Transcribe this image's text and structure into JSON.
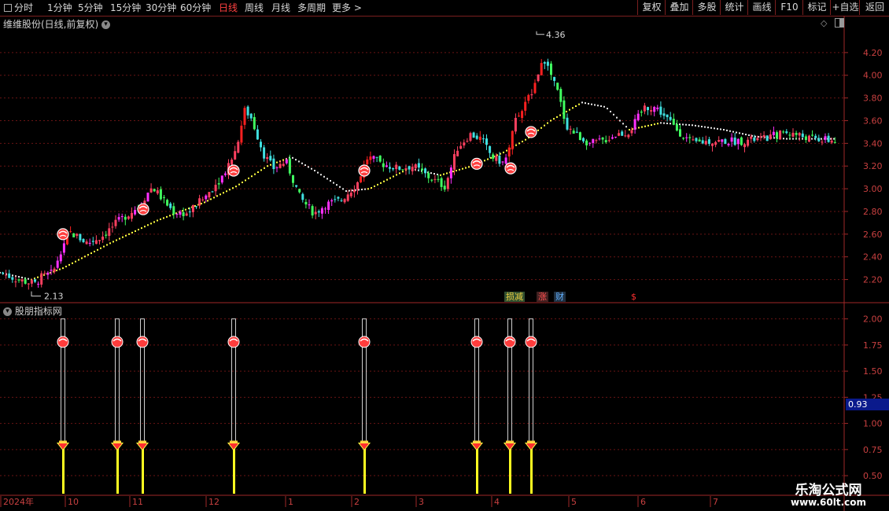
{
  "toolbar": {
    "left": [
      {
        "label": "分时",
        "x": 18,
        "active": false
      },
      {
        "label": "1分钟",
        "x": 60,
        "active": false
      },
      {
        "label": "5分钟",
        "x": 99,
        "active": false
      },
      {
        "label": "15分钟",
        "x": 140,
        "active": false
      },
      {
        "label": "30分钟",
        "x": 185,
        "active": false
      },
      {
        "label": "60分钟",
        "x": 229,
        "active": false
      },
      {
        "label": "日线",
        "x": 278,
        "active": true
      },
      {
        "label": "周线",
        "x": 311,
        "active": false
      },
      {
        "label": "月线",
        "x": 345,
        "active": false
      },
      {
        "label": "多周期",
        "x": 378,
        "active": false
      },
      {
        "label": "更多 >",
        "x": 422,
        "active": false
      }
    ],
    "right": [
      {
        "label": "复权",
        "x": 810,
        "w": 35
      },
      {
        "label": "叠加",
        "x": 845,
        "w": 35
      },
      {
        "label": "多股",
        "x": 880,
        "w": 35
      },
      {
        "label": "统计",
        "x": 915,
        "w": 35
      },
      {
        "label": "画线",
        "x": 950,
        "w": 35
      },
      {
        "label": "F10",
        "x": 985,
        "w": 35
      },
      {
        "label": "标记",
        "x": 1020,
        "w": 35
      },
      {
        "label": "+自选",
        "x": 1055,
        "w": 37
      },
      {
        "label": "返回",
        "x": 1092,
        "w": 38
      }
    ]
  },
  "main_chart": {
    "title": "维维股份(日线,前复权)",
    "high_label": "4.36",
    "low_label": "2.13",
    "y_ticks": [
      "4.20",
      "4.00",
      "3.80",
      "3.60",
      "3.40",
      "3.20",
      "3.00",
      "2.80",
      "2.60",
      "2.40",
      "2.20"
    ],
    "ylim": [
      2.1,
      4.4
    ],
    "news_icons": [
      {
        "label": "损减",
        "color": "#f0d040",
        "bg": "#305030"
      },
      {
        "label": "涨",
        "color": "#ff5050",
        "bg": "#402020"
      },
      {
        "label": "财",
        "color": "#60b0ff",
        "bg": "#203040"
      },
      {
        "label": "$",
        "color": "#ff3030",
        "bg": "#000000"
      }
    ]
  },
  "indicator": {
    "title": "股朋指标网",
    "y_ticks": [
      "2.00",
      "1.75",
      "1.50",
      "1.25",
      "1.00",
      "0.75",
      "0.50"
    ],
    "ylim": [
      0.35,
      2.08
    ],
    "current_value": "0.93",
    "signal_positions": [
      80,
      149,
      181,
      297,
      463,
      606,
      648,
      675
    ]
  },
  "x_axis": {
    "labels": [
      {
        "text": "2024年",
        "x": 4
      },
      {
        "text": "10",
        "x": 86
      },
      {
        "text": "11",
        "x": 168
      },
      {
        "text": "12",
        "x": 265
      },
      {
        "text": "1",
        "x": 366
      },
      {
        "text": "2",
        "x": 450
      },
      {
        "text": "3",
        "x": 532
      },
      {
        "text": "4",
        "x": 628
      },
      {
        "text": "5",
        "x": 726
      },
      {
        "text": "6",
        "x": 814
      },
      {
        "text": "7",
        "x": 906
      }
    ]
  },
  "watermark": {
    "title": "乐淘公式网",
    "url": "www.60lt.com"
  },
  "chart_data": {
    "type": "candlestick",
    "title": "维维股份(日线,前复权)",
    "ylim": [
      2.1,
      4.4
    ],
    "grid": true,
    "pivots": [
      [
        0,
        2.26
      ],
      [
        20,
        2.2
      ],
      [
        44,
        2.16
      ],
      [
        50,
        2.22
      ],
      [
        66,
        2.26
      ],
      [
        76,
        2.46
      ],
      [
        86,
        2.62
      ],
      [
        96,
        2.58
      ],
      [
        110,
        2.52
      ],
      [
        128,
        2.58
      ],
      [
        150,
        2.72
      ],
      [
        174,
        2.84
      ],
      [
        192,
        3.02
      ],
      [
        206,
        2.9
      ],
      [
        218,
        2.8
      ],
      [
        236,
        2.78
      ],
      [
        258,
        2.92
      ],
      [
        280,
        3.1
      ],
      [
        298,
        3.34
      ],
      [
        310,
        3.7
      ],
      [
        318,
        3.62
      ],
      [
        334,
        3.3
      ],
      [
        346,
        3.18
      ],
      [
        362,
        3.24
      ],
      [
        380,
        2.92
      ],
      [
        398,
        2.78
      ],
      [
        412,
        2.86
      ],
      [
        432,
        2.9
      ],
      [
        452,
        3.04
      ],
      [
        466,
        3.28
      ],
      [
        484,
        3.22
      ],
      [
        504,
        3.18
      ],
      [
        524,
        3.2
      ],
      [
        544,
        3.1
      ],
      [
        564,
        3.02
      ],
      [
        580,
        3.36
      ],
      [
        596,
        3.48
      ],
      [
        610,
        3.44
      ],
      [
        624,
        3.28
      ],
      [
        640,
        3.22
      ],
      [
        652,
        3.58
      ],
      [
        666,
        3.74
      ],
      [
        680,
        3.95
      ],
      [
        688,
        4.18
      ],
      [
        696,
        4.05
      ],
      [
        708,
        3.84
      ],
      [
        718,
        3.56
      ],
      [
        730,
        3.48
      ],
      [
        748,
        3.4
      ],
      [
        764,
        3.42
      ],
      [
        782,
        3.48
      ],
      [
        798,
        3.5
      ],
      [
        818,
        3.72
      ],
      [
        832,
        3.72
      ],
      [
        846,
        3.62
      ],
      [
        862,
        3.5
      ],
      [
        878,
        3.4
      ],
      [
        900,
        3.42
      ],
      [
        940,
        3.42
      ],
      [
        970,
        3.44
      ],
      [
        996,
        3.5
      ],
      [
        1010,
        3.48
      ],
      [
        1030,
        3.44
      ],
      [
        1060,
        3.42
      ]
    ],
    "ma_pivots": [
      [
        0,
        2.26
      ],
      [
        40,
        2.2
      ],
      [
        80,
        2.3
      ],
      [
        140,
        2.52
      ],
      [
        200,
        2.72
      ],
      [
        260,
        2.88
      ],
      [
        300,
        3.02
      ],
      [
        340,
        3.2
      ],
      [
        370,
        3.28
      ],
      [
        400,
        3.16
      ],
      [
        440,
        2.98
      ],
      [
        470,
        3.0
      ],
      [
        520,
        3.18
      ],
      [
        560,
        3.12
      ],
      [
        600,
        3.2
      ],
      [
        640,
        3.32
      ],
      [
        670,
        3.44
      ],
      [
        700,
        3.6
      ],
      [
        740,
        3.76
      ],
      [
        770,
        3.72
      ],
      [
        800,
        3.52
      ],
      [
        840,
        3.58
      ],
      [
        880,
        3.56
      ],
      [
        920,
        3.52
      ],
      [
        960,
        3.46
      ],
      [
        1000,
        3.44
      ],
      [
        1060,
        3.44
      ]
    ],
    "buy_markers": [
      {
        "x": 80,
        "price": 2.6
      },
      {
        "x": 182,
        "price": 2.82
      },
      {
        "x": 297,
        "price": 3.16
      },
      {
        "x": 463,
        "price": 3.16
      },
      {
        "x": 606,
        "price": 3.22
      },
      {
        "x": 649,
        "price": 3.18
      },
      {
        "x": 675,
        "price": 3.5
      }
    ]
  }
}
